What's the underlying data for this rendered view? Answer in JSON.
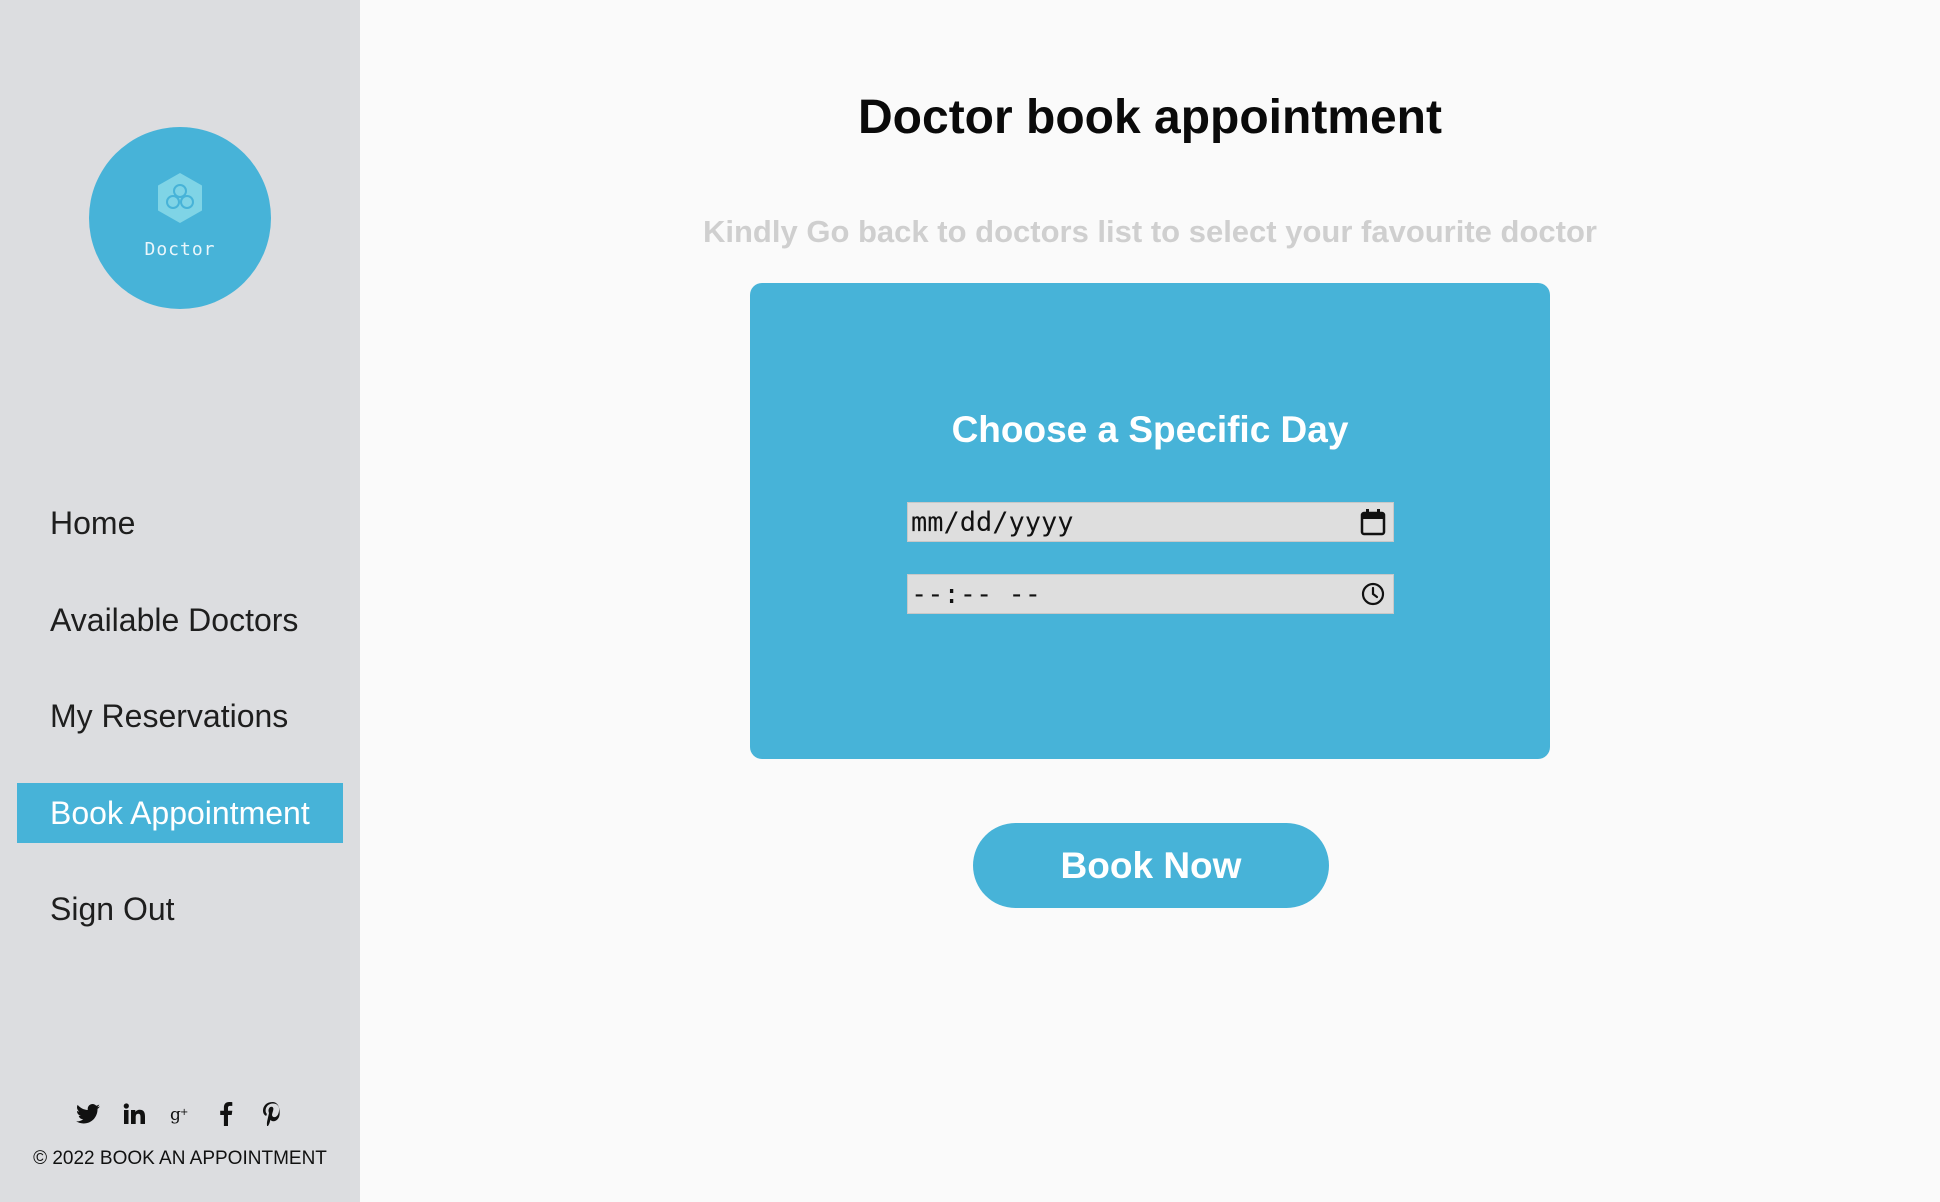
{
  "sidebar": {
    "logo_text": "Doctor",
    "nav": [
      {
        "label": "Home",
        "active": false
      },
      {
        "label": "Available Doctors",
        "active": false
      },
      {
        "label": "My Reservations",
        "active": false
      },
      {
        "label": "Book Appointment",
        "active": true
      },
      {
        "label": "Sign Out",
        "active": false
      }
    ],
    "social_icons": [
      "twitter-icon",
      "linkedin-icon",
      "google-plus-icon",
      "facebook-icon",
      "pinterest-icon"
    ],
    "copyright": "© 2022 BOOK AN APPOINTMENT"
  },
  "main": {
    "title": "Doctor book appointment",
    "subtitle": "Kindly Go back to doctors list to select your favourite doctor",
    "card": {
      "title": "Choose a Specific Day",
      "date_value": "mm/dd/yyyy",
      "time_value": "--:-- --"
    },
    "book_label": "Book Now"
  },
  "colors": {
    "accent": "#47b3d8",
    "sidebar_bg": "#dcdde0",
    "page_bg": "#fafafa",
    "subtitle": "#cfcfcf"
  }
}
